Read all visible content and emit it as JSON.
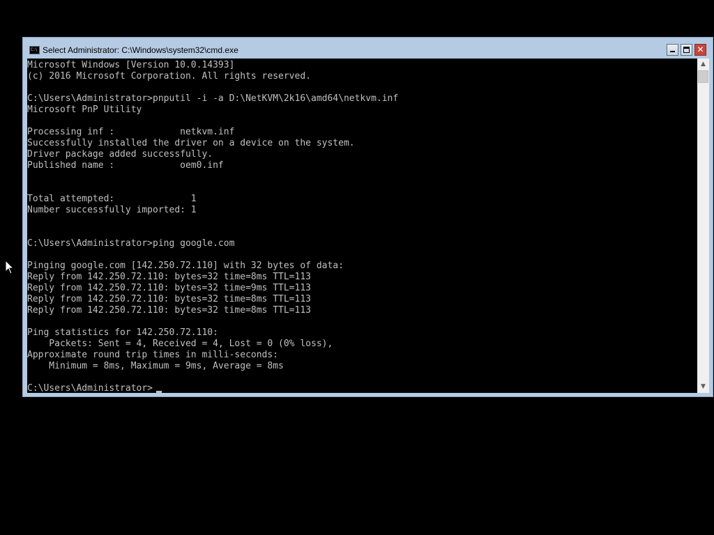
{
  "window": {
    "title": "Select Administrator: C:\\Windows\\system32\\cmd.exe",
    "icon_text": "C:\\"
  },
  "console": {
    "text": "Microsoft Windows [Version 10.0.14393]\n(c) 2016 Microsoft Corporation. All rights reserved.\n\nC:\\Users\\Administrator>pnputil -i -a D:\\NetKVM\\2k16\\amd64\\netkvm.inf\nMicrosoft PnP Utility\n\nProcessing inf :            netkvm.inf\nSuccessfully installed the driver on a device on the system.\nDriver package added successfully.\nPublished name :            oem0.inf\n\n\nTotal attempted:              1\nNumber successfully imported: 1\n\n\nC:\\Users\\Administrator>ping google.com\n\nPinging google.com [142.250.72.110] with 32 bytes of data:\nReply from 142.250.72.110: bytes=32 time=8ms TTL=113\nReply from 142.250.72.110: bytes=32 time=9ms TTL=113\nReply from 142.250.72.110: bytes=32 time=8ms TTL=113\nReply from 142.250.72.110: bytes=32 time=8ms TTL=113\n\nPing statistics for 142.250.72.110:\n    Packets: Sent = 4, Received = 4, Lost = 0 (0% loss),\nApproximate round trip times in milli-seconds:\n    Minimum = 8ms, Maximum = 9ms, Average = 8ms\n\nC:\\Users\\Administrator>"
  },
  "controls": {
    "minimize_icon": "minimize-icon",
    "maximize_icon": "maximize-icon",
    "close_icon": "close-icon",
    "close_glyph": "✕"
  },
  "colors": {
    "console_bg": "#000000",
    "console_fg": "#c0c0c0",
    "titlebar_bg": "#b5cbe3",
    "close_button": "#c7463b"
  }
}
